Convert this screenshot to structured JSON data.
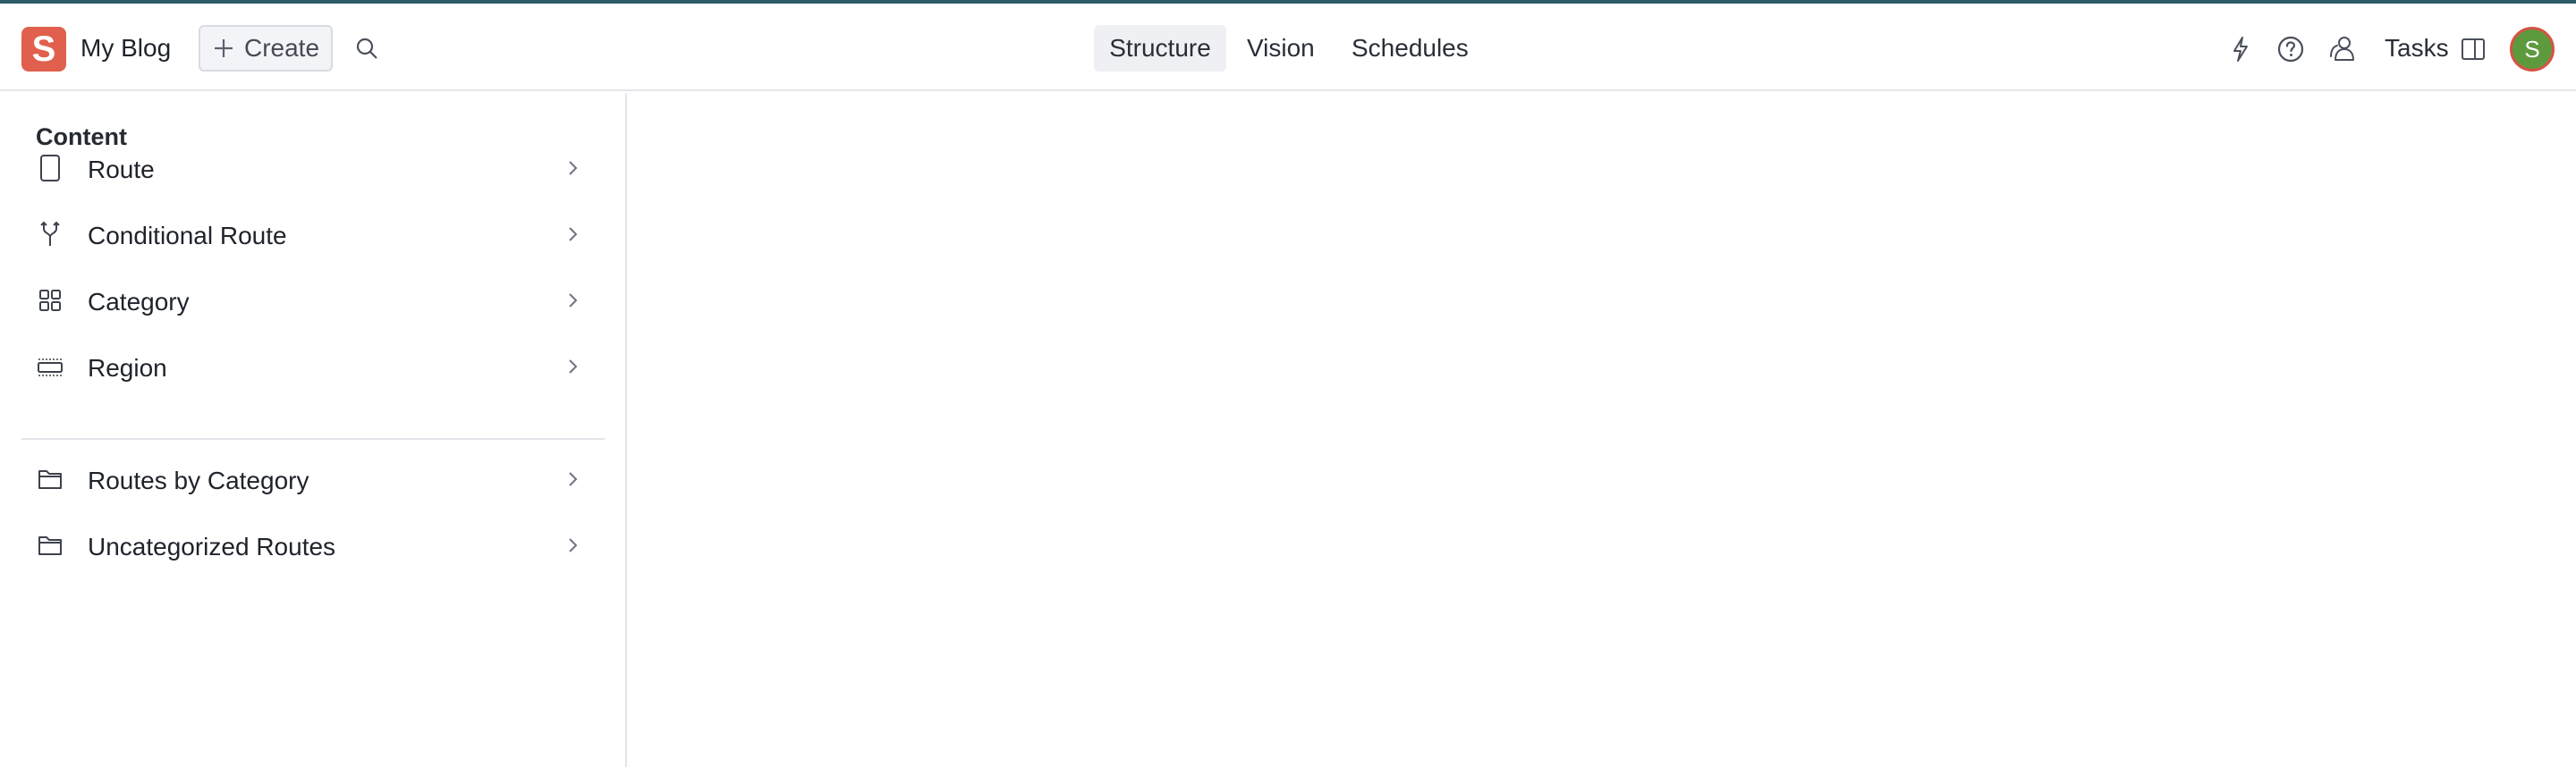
{
  "header": {
    "logo_letter": "S",
    "project_title": "My Blog",
    "create_label": "Create",
    "tabs": [
      {
        "label": "Structure",
        "active": true
      },
      {
        "label": "Vision",
        "active": false
      },
      {
        "label": "Schedules",
        "active": false
      }
    ],
    "tasks_label": "Tasks",
    "avatar_initial": "S"
  },
  "sidebar": {
    "heading": "Content",
    "items": [
      {
        "label": "Route",
        "icon": "document-icon"
      },
      {
        "label": "Conditional Route",
        "icon": "branch-icon"
      },
      {
        "label": "Category",
        "icon": "grid-icon"
      },
      {
        "label": "Region",
        "icon": "region-icon"
      },
      {
        "label": "Routes by Category",
        "icon": "folder-icon"
      },
      {
        "label": "Uncategorized Routes",
        "icon": "folder-icon"
      }
    ]
  },
  "colors": {
    "brand": "#e0604d",
    "topline": "#2d5c69",
    "avatar_bg": "#5d9a3e",
    "avatar_ring": "#d65344"
  }
}
